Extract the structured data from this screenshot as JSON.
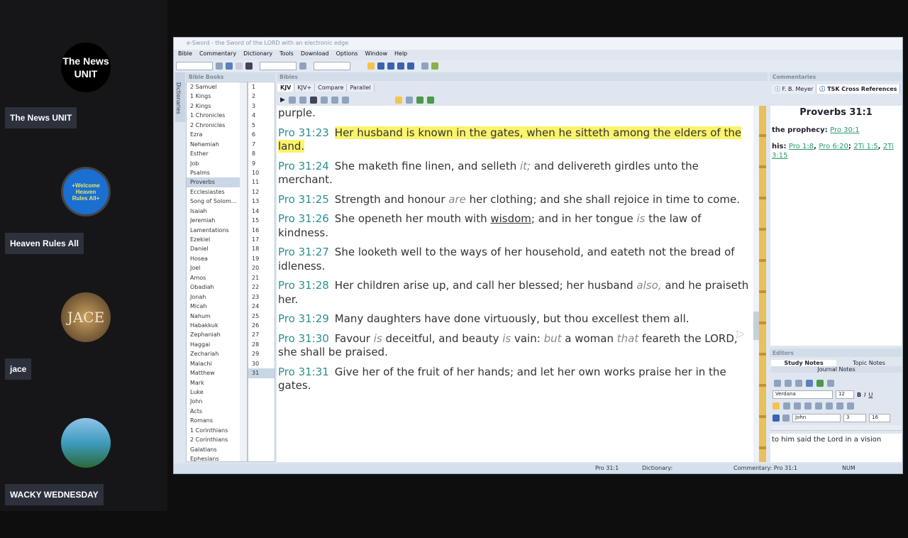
{
  "sidebar": {
    "participants": [
      {
        "name": "The News UNIT",
        "avatar_text": "The News UNIT"
      },
      {
        "name": "Heaven Rules All",
        "avatar_text": "+Welcome Heaven Rules All+"
      },
      {
        "name": "jace",
        "avatar_text": "JACE"
      },
      {
        "name": "WACKY WEDNESDAY",
        "avatar_text": ""
      }
    ]
  },
  "window": {
    "title": "e-Sword - the Sword of the LORD with an electronic edge",
    "menu": [
      "Bible",
      "Commentary",
      "Dictionary",
      "Tools",
      "Download",
      "Options",
      "Window",
      "Help"
    ]
  },
  "left": {
    "dictionaries_tab": "Dictionaries",
    "header": "Bible Books",
    "books": [
      "2 Samuel",
      "1 Kings",
      "2 Kings",
      "1 Chronicles",
      "2 Chronicles",
      "Ezra",
      "Nehemiah",
      "Esther",
      "Job",
      "Psalms",
      "Proverbs",
      "Ecclesiastes",
      "Song of Solom...",
      "Isaiah",
      "Jeremiah",
      "Lamentations",
      "Ezekiel",
      "Daniel",
      "Hosea",
      "Joel",
      "Amos",
      "Obadiah",
      "Jonah",
      "Micah",
      "Nahum",
      "Habakkuk",
      "Zephaniah",
      "Haggai",
      "Zechariah",
      "Malachi",
      "Matthew",
      "Mark",
      "Luke",
      "John",
      "Acts",
      "Romans",
      "1 Corinthians",
      "2 Corinthians",
      "Galatians",
      "Ephesians"
    ],
    "selected_book": "Proverbs",
    "chapters": [
      "1",
      "2",
      "3",
      "4",
      "5",
      "6",
      "7",
      "8",
      "9",
      "10",
      "11",
      "12",
      "13",
      "14",
      "15",
      "16",
      "17",
      "18",
      "19",
      "20",
      "21",
      "22",
      "23",
      "24",
      "25",
      "26",
      "27",
      "28",
      "29",
      "30",
      "31"
    ],
    "selected_chapter": "31"
  },
  "bibles": {
    "header": "Bibles",
    "tabs": [
      "KJV",
      "KJV+",
      "Compare",
      "Parallel"
    ],
    "active_tab": "KJV",
    "leading": "purple.",
    "verses": [
      {
        "ref": "Pro 31:23",
        "parts": [
          {
            "t": "Her husband is known in the gates, when he sitteth among the elders of the land.",
            "s": "hl"
          }
        ]
      },
      {
        "ref": "Pro 31:24",
        "parts": [
          {
            "t": "She maketh fine linen, and selleth "
          },
          {
            "t": "it;",
            "s": "it"
          },
          {
            "t": " and delivereth girdles unto the merchant."
          }
        ]
      },
      {
        "ref": "Pro 31:25",
        "parts": [
          {
            "t": "Strength and honour "
          },
          {
            "t": "are",
            "s": "it"
          },
          {
            "t": " her clothing; and she shall rejoice in time to come."
          }
        ]
      },
      {
        "ref": "Pro 31:26",
        "parts": [
          {
            "t": "She openeth her mouth with "
          },
          {
            "t": "wisdom",
            "s": "u"
          },
          {
            "t": "; and in her tongue "
          },
          {
            "t": "is",
            "s": "it"
          },
          {
            "t": " the law of kindness."
          }
        ]
      },
      {
        "ref": "Pro 31:27",
        "parts": [
          {
            "t": "She looketh well to the ways of her household, and eateth not the bread of idleness."
          }
        ]
      },
      {
        "ref": "Pro 31:28",
        "parts": [
          {
            "t": "Her children arise up, and call her blessed; her husband "
          },
          {
            "t": "also,",
            "s": "it"
          },
          {
            "t": " and he praiseth her."
          }
        ]
      },
      {
        "ref": "Pro 31:29",
        "parts": [
          {
            "t": "Many daughters have done virtuously, but thou excellest them all."
          }
        ]
      },
      {
        "ref": "Pro 31:30",
        "parts": [
          {
            "t": "Favour "
          },
          {
            "t": "is",
            "s": "it"
          },
          {
            "t": " deceitful, and beauty "
          },
          {
            "t": "is",
            "s": "it"
          },
          {
            "t": " vain: "
          },
          {
            "t": "but",
            "s": "it"
          },
          {
            "t": " a woman "
          },
          {
            "t": "that",
            "s": "it"
          },
          {
            "t": " feareth the LORD, she shall be praised."
          }
        ]
      },
      {
        "ref": "Pro 31:31",
        "parts": [
          {
            "t": "Give her of the fruit of her hands; and let her own works praise her in the gates."
          }
        ]
      }
    ]
  },
  "commentaries": {
    "header": "Commentaries",
    "tabs": [
      "F. B. Meyer",
      "TSK Cross References"
    ],
    "title": "Proverbs 31:1",
    "entry1_label": "the prophecy:",
    "entry1_links": [
      "Pro 30:1"
    ],
    "entry2_label": "his:",
    "entry2_links": [
      "Pro 1:8",
      "Pro 6:20",
      "2Ti 1:5",
      "2Ti 3:15"
    ]
  },
  "editors": {
    "header": "Editors",
    "tabs": [
      "Study Notes",
      "Topic Notes",
      "Journal Notes"
    ],
    "font": "Verdana",
    "size": "12",
    "book": "John",
    "chapter": "3",
    "verse": "16",
    "text": "to him said the Lord in a vision"
  },
  "status": {
    "ref": "Pro 31:1",
    "dictionary": "Dictionary:",
    "commentary": "Commentary: Pro 31:1",
    "num": "NUM"
  }
}
